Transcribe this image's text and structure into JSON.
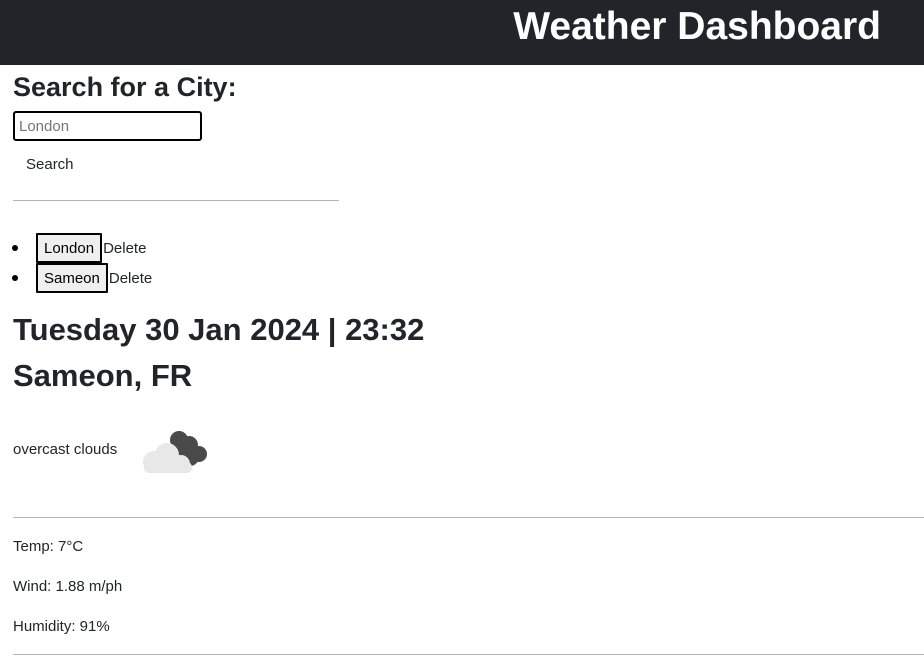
{
  "header": {
    "title": "Weather Dashboard"
  },
  "search": {
    "heading": "Search for a City:",
    "placeholder": "London",
    "button_label": "Search"
  },
  "history": [
    {
      "city": "London",
      "delete_label": "Delete"
    },
    {
      "city": "Sameon",
      "delete_label": "Delete"
    }
  ],
  "current": {
    "date_time": "Tuesday 30 Jan 2024 | 23:32",
    "location": "Sameon, FR",
    "description": "overcast clouds",
    "icon": "overcast-clouds-icon",
    "temp": "Temp: 7°C",
    "wind": "Wind: 1.88 m/ph",
    "humidity": "Humidity: 91%"
  },
  "colors": {
    "header_bg": "#212529",
    "header_text": "#ffffff",
    "text": "#212529"
  }
}
